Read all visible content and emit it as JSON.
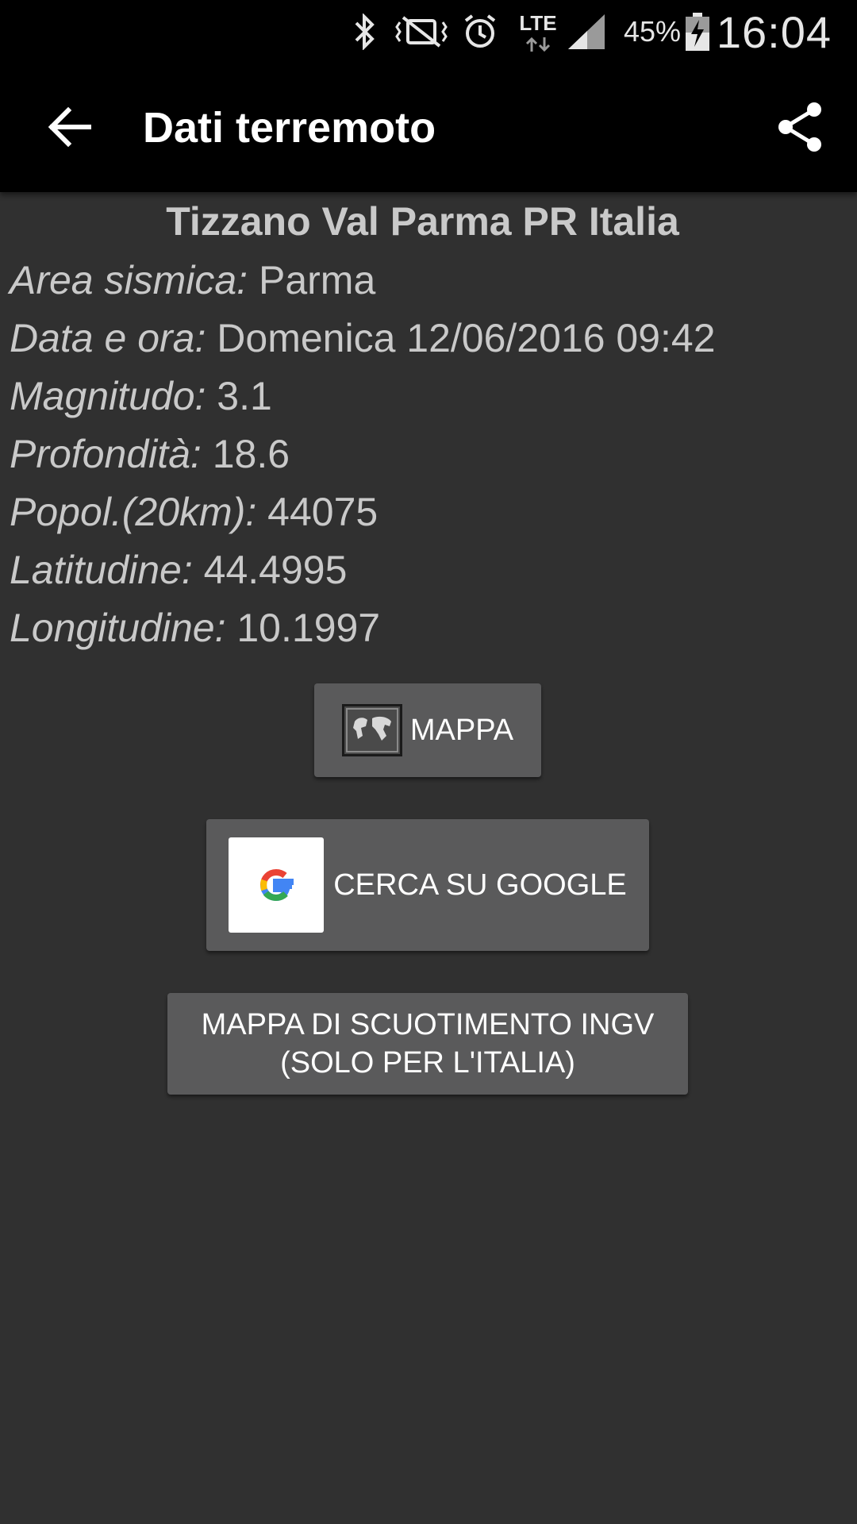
{
  "status_bar": {
    "lte_label": "LTE",
    "battery_percent": "45%",
    "time": "16:04"
  },
  "toolbar": {
    "title": "Dati terremoto"
  },
  "quake": {
    "place": "Tizzano Val Parma PR Italia",
    "rows": [
      {
        "label": "Area sismica:",
        "value": "Parma"
      },
      {
        "label": "Data e ora:",
        "value": "Domenica 12/06/2016 09:42"
      },
      {
        "label": "Magnitudo:",
        "value": "3.1"
      },
      {
        "label": "Profondità:",
        "value": "18.6"
      },
      {
        "label": "Popol.(20km):",
        "value": "44075"
      },
      {
        "label": "Latitudine:",
        "value": "44.4995"
      },
      {
        "label": "Longitudine:",
        "value": "10.1997"
      }
    ]
  },
  "buttons": {
    "map": "MAPPA",
    "google": "CERCA SU GOOGLE",
    "shake_line1": "MAPPA DI SCUOTIMENTO INGV",
    "shake_line2": "(SOLO PER L'ITALIA)"
  }
}
